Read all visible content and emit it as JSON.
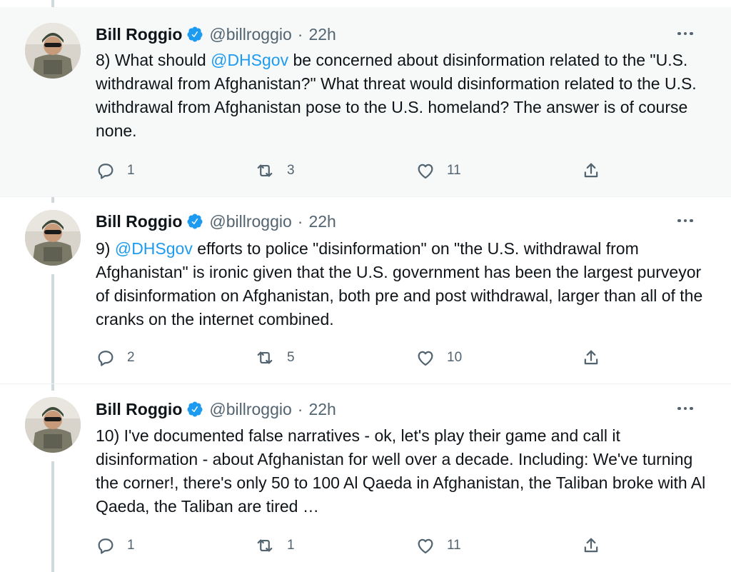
{
  "tweets": [
    {
      "author": "Bill Roggio",
      "handle": "@billroggio",
      "separator": "·",
      "time": "22h",
      "text_parts": [
        {
          "t": "8) What should "
        },
        {
          "t": "@DHSgov",
          "mention": true
        },
        {
          "t": " be concerned about disinformation related to the \"U.S. withdrawal from Afghanistan?\" What threat would disinformation related to the U.S. withdrawal from Afghanistan pose to the U.S. homeland? The answer is of course none."
        }
      ],
      "replies": "1",
      "retweets": "3",
      "likes": "11"
    },
    {
      "author": "Bill Roggio",
      "handle": "@billroggio",
      "separator": "·",
      "time": "22h",
      "text_parts": [
        {
          "t": "9) "
        },
        {
          "t": "@DHSgov",
          "mention": true
        },
        {
          "t": " efforts to police \"disinformation\" on \"the U.S. withdrawal from Afghanistan\" is ironic given that the U.S. government has been the largest purveyor of disinformation on Afghanistan, both pre and post withdrawal, larger than all of the cranks on the internet combined."
        }
      ],
      "replies": "2",
      "retweets": "5",
      "likes": "10"
    },
    {
      "author": "Bill Roggio",
      "handle": "@billroggio",
      "separator": "·",
      "time": "22h",
      "text_parts": [
        {
          "t": "10) I've documented false narratives - ok, let's play their game and call it disinformation - about Afghanistan for well over a decade. Including: We've turning the corner!, there's only 50 to 100 Al Qaeda in Afghanistan, the Taliban broke with Al Qaeda, the Taliban are tired …"
        }
      ],
      "replies": "1",
      "retweets": "1",
      "likes": "11"
    }
  ],
  "icons": {
    "reply": "reply-icon",
    "retweet": "retweet-icon",
    "like": "like-icon",
    "share": "share-icon",
    "verified": "verified-badge-icon",
    "more": "more-options-icon"
  },
  "colors": {
    "mention": "#1d9bf0",
    "verified": "#1d9bf0",
    "muted": "#536471",
    "highlight_bg": "#f7f9f9",
    "thread_line": "#cfd9de"
  }
}
